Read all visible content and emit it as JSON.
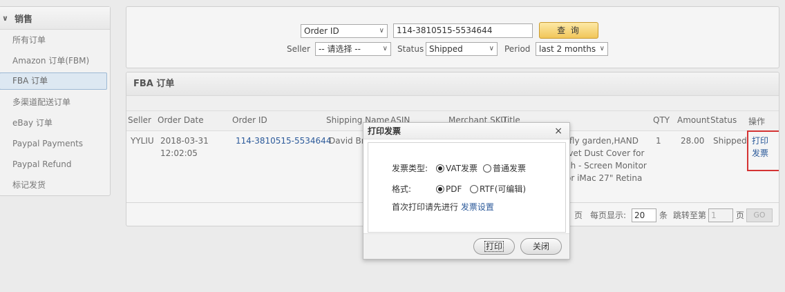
{
  "sidebar": {
    "header": "销售",
    "items": [
      {
        "label": "所有订单"
      },
      {
        "label": "Amazon 订单(FBM)"
      },
      {
        "label": "FBA 订单"
      },
      {
        "label": "多渠道配送订单"
      },
      {
        "label": "eBay 订单"
      },
      {
        "label": "Paypal Payments"
      },
      {
        "label": "Paypal Refund"
      },
      {
        "label": "标记发货"
      }
    ]
  },
  "search": {
    "field_select": "Order ID",
    "query_value": "114-3810515-5534644",
    "query_button": "查 询",
    "seller_label": "Seller",
    "seller_value": "-- 请选择 --",
    "status_label": "Status",
    "status_value": "Shipped",
    "period_label": "Period",
    "period_value": "last 2 months"
  },
  "fba": {
    "title": "FBA 订单",
    "columns": {
      "seller": "Seller",
      "order_date": "Order Date",
      "order_id": "Order ID",
      "shipping_name": "Shipping Name",
      "asin": "ASIN",
      "merchant_sku": "Merchant SKU",
      "title": "Title",
      "qty": "QTY",
      "amount": "Amount",
      "status": "Status",
      "ops": "操作"
    },
    "row": {
      "seller": "YYLIU",
      "order_date": "2018-03-31",
      "order_time": "12:02:05",
      "order_id": "114-3810515-5534644",
      "shipping_name": "David Bru",
      "title_l1": "rfly garden,HAND",
      "title_l2": "lvet Dust Cover for",
      "title_l3": "ch - Screen Monitor",
      "title_l4": "or iMac 27\" Retina",
      "qty": "1",
      "amount": "28.00",
      "status": "Shipped",
      "op_print": "打印",
      "op_invoice": "发票"
    },
    "pager": {
      "page_suffix": "页",
      "per_page_label": "每页显示:",
      "per_page_value": "20",
      "per_page_unit": "条",
      "jump_label": "跳转至第",
      "jump_value": "1",
      "jump_unit": "页",
      "go": "GO"
    }
  },
  "dialog": {
    "title": "打印发票",
    "close": "×",
    "type_label": "发票类型:",
    "type_vat": "VAT发票",
    "type_normal": "普通发票",
    "format_label": "格式:",
    "format_pdf": "PDF",
    "format_rtf": "RTF(可编辑)",
    "hint": "首次打印请先进行",
    "hint_link": "发票设置",
    "print_button": "打印",
    "close_button": "关闭"
  },
  "colors": {
    "accent_link": "#2c5a9a",
    "highlight_box": "#d43333",
    "query_button": "#f1c65a"
  }
}
